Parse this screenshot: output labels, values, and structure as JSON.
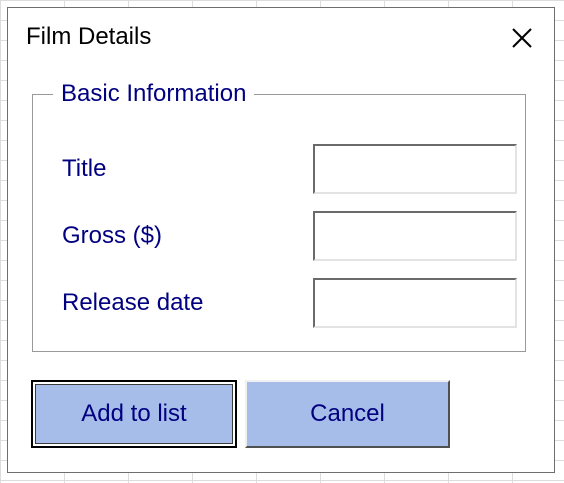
{
  "dialog": {
    "title": "Film Details",
    "close_icon": "close-icon"
  },
  "group": {
    "legend": "Basic Information",
    "fields": [
      {
        "label": "Title",
        "value": "",
        "placeholder": ""
      },
      {
        "label": "Gross ($)",
        "value": "",
        "placeholder": ""
      },
      {
        "label": "Release date",
        "value": "",
        "placeholder": ""
      }
    ]
  },
  "buttons": {
    "add_label": "Add to list",
    "cancel_label": "Cancel"
  },
  "colors": {
    "label_text": "#000080",
    "button_fill": "#a5bde8",
    "dialog_border": "#6e6e6e"
  }
}
